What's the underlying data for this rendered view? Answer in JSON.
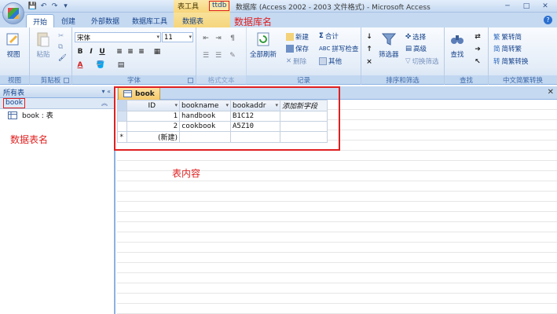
{
  "titlebar": {
    "context_group": "表工具",
    "db_name": "ttdb",
    "title": "数据库 (Access 2002 - 2003 文件格式) - Microsoft Access",
    "qat": [
      "save-icon",
      "undo-icon",
      "redo-icon",
      "customize-icon"
    ]
  },
  "tabs": [
    "开始",
    "创建",
    "外部数据",
    "数据库工具",
    "数据表"
  ],
  "annotations": {
    "db_name": "数据库名",
    "table_name": "数据表名",
    "content": "表内容"
  },
  "ribbon": {
    "view": {
      "label": "视图",
      "group": "视图"
    },
    "clipboard": {
      "paste": "粘贴",
      "group": "剪贴板"
    },
    "font": {
      "name": "宋体",
      "size": "11",
      "group": "字体"
    },
    "richtext": {
      "group": "格式文本"
    },
    "records": {
      "refresh": "全部刷新",
      "new": "新建",
      "save": "保存",
      "delete": "删除",
      "sum": "合计",
      "spell": "拼写检查",
      "more": "其他",
      "group": "记录"
    },
    "sort": {
      "filter": "筛选器",
      "select": "选择",
      "advanced": "高级",
      "toggle": "切换筛选",
      "group": "排序和筛选"
    },
    "find": {
      "find": "查找",
      "group": "查找"
    },
    "convert": {
      "t2s": "繁转简",
      "s2t": "简转繁",
      "conv": "简繁转换",
      "group": "中文简繁转换"
    }
  },
  "nav": {
    "header": "所有表",
    "group": "book",
    "item": "book : 表"
  },
  "document": {
    "tab": "book",
    "columns": [
      "ID",
      "bookname",
      "bookaddr",
      "添加新字段"
    ],
    "rows": [
      {
        "id": "1",
        "bookname": "handbook",
        "bookaddr": "B1C12"
      },
      {
        "id": "2",
        "bookname": "cookbook",
        "bookaddr": "A5Z10"
      }
    ],
    "new_row": "(新建)",
    "new_row_marker": "*"
  }
}
